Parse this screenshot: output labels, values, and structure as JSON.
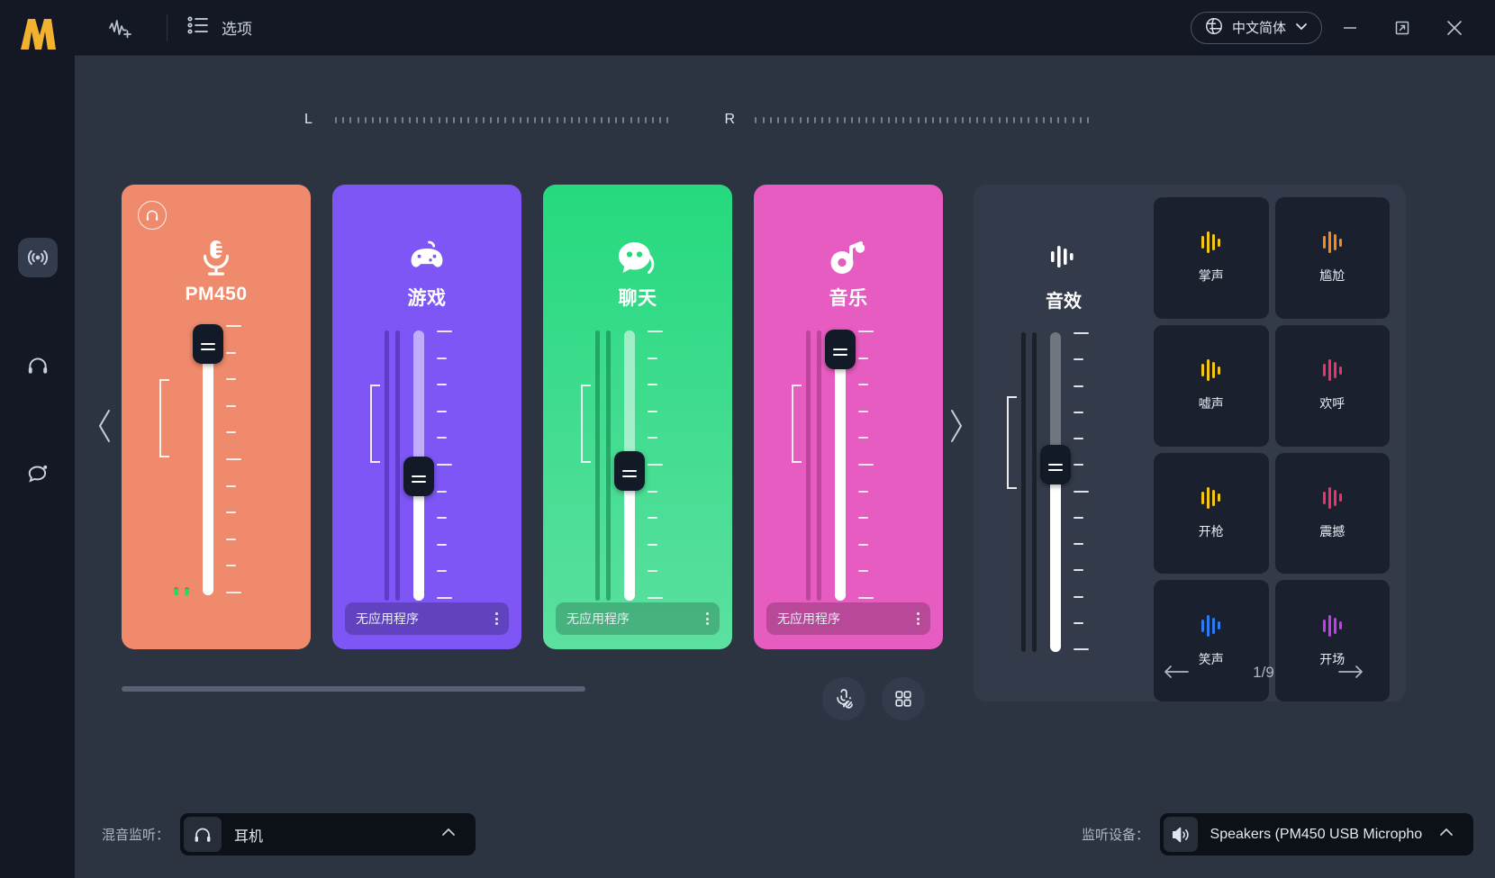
{
  "titlebar": {
    "add_effect_icon": "waveform-plus-icon",
    "options_icon": "list-options-icon",
    "options_label": "选项",
    "language_icon": "globe-icon",
    "language_label": "中文简体",
    "language_caret_icon": "chevron-down-icon",
    "minimize_icon": "minimize-icon",
    "restore_icon": "expand-icon",
    "close_icon": "close-icon"
  },
  "rail": {
    "logo": "m-logo",
    "items": [
      {
        "name": "mixer",
        "icon": "broadcast-icon",
        "active": true
      },
      {
        "name": "monitor",
        "icon": "headphones-icon",
        "active": false
      },
      {
        "name": "chat",
        "icon": "chat-bubble-icon",
        "active": false
      }
    ]
  },
  "meters": {
    "left_label": "L",
    "right_label": "R",
    "left_dots": 46,
    "right_dots": 46
  },
  "nav": {
    "prev_icon": "chevron-left-icon",
    "next_icon": "chevron-right-icon"
  },
  "strips": [
    {
      "name": "PM450",
      "color": "#F08A6C",
      "icon": "microphone-icon",
      "monitor_icon": "headphones-circle-icon",
      "has_monitor_badge": true,
      "has_app_selector": false,
      "app_label": "",
      "track_bg": "rgba(255,255,255,0.30)",
      "vu_color": "rgba(150,70,45,0.55)",
      "fill_pct": 0,
      "knob_pct": 97,
      "vu_level_a": 3,
      "vu_level_b": 3,
      "peak_dots": true
    },
    {
      "name": "游戏",
      "color": "#7D56F5",
      "icon": "gamepad-icon",
      "monitor_icon": "",
      "has_monitor_badge": false,
      "has_app_selector": true,
      "app_label": "无应用程序",
      "app_bg": "rgba(0,0,0,0.22)",
      "track_bg": "rgba(255,255,255,0.52)",
      "vu_color": "rgba(70,40,160,0.55)",
      "fill_pct": 50,
      "knob_pct": 50,
      "vu_level_a": 100,
      "vu_level_b": 100,
      "peak_dots": false
    },
    {
      "name": "聊天",
      "color": "#25D97E",
      "color2": "#5CE0A0",
      "icon": "chat-face-icon",
      "monitor_icon": "",
      "has_monitor_badge": false,
      "has_app_selector": true,
      "app_label": "无应用程序",
      "app_bg": "rgba(0,0,0,0.20)",
      "track_bg": "rgba(255,255,255,0.52)",
      "vu_color": "rgba(20,120,70,0.55)",
      "fill_pct": 52,
      "knob_pct": 52,
      "vu_level_a": 100,
      "vu_level_b": 100,
      "peak_dots": false
    },
    {
      "name": "音乐",
      "color": "#E75CC0",
      "icon": "music-note-icon",
      "monitor_icon": "",
      "has_monitor_badge": false,
      "has_app_selector": true,
      "app_label": "无应用程序",
      "app_bg": "rgba(0,0,0,0.20)",
      "track_bg": "rgba(255,255,255,0.30)",
      "vu_color": "rgba(150,55,120,0.55)",
      "fill_pct": 0,
      "knob_pct": 97,
      "vu_level_a": 100,
      "vu_level_b": 100,
      "peak_dots": false
    }
  ],
  "toolbar_bottom": {
    "mute_mic_icon": "mic-off-icon",
    "grid_icon": "grid-icon"
  },
  "effects": {
    "title": "音效",
    "icon": "equalizer-icon",
    "fader": {
      "fill_pct": 0,
      "knob_pct": 62,
      "track_bg": "rgba(255,255,255,0.30)"
    },
    "items": [
      {
        "label": "掌声",
        "color": "#F5C518"
      },
      {
        "label": "尴尬",
        "color": "#F58A18"
      },
      {
        "label": "嘘声",
        "color": "#F5C518"
      },
      {
        "label": "欢呼",
        "color": "#F0306A"
      },
      {
        "label": "开枪",
        "color": "#F5C518"
      },
      {
        "label": "震撼",
        "color": "#F0306A"
      },
      {
        "label": "笑声",
        "color": "#2B7CF0"
      },
      {
        "label": "开场",
        "color": "#C838F0"
      }
    ],
    "page_label": "1/9",
    "prev_icon": "arrow-left-icon",
    "next_icon": "arrow-right-icon"
  },
  "bottombar": {
    "monitor_mix_label": "混音监听：",
    "monitor_mix_icon": "headphones-icon",
    "monitor_mix_value": "耳机",
    "monitor_mix_caret": "chevron-up-icon",
    "monitor_device_label": "监听设备：",
    "monitor_device_icon": "speaker-icon",
    "monitor_device_value": "Speakers (PM450 USB Micropho...",
    "monitor_device_caret": "chevron-up-icon"
  }
}
